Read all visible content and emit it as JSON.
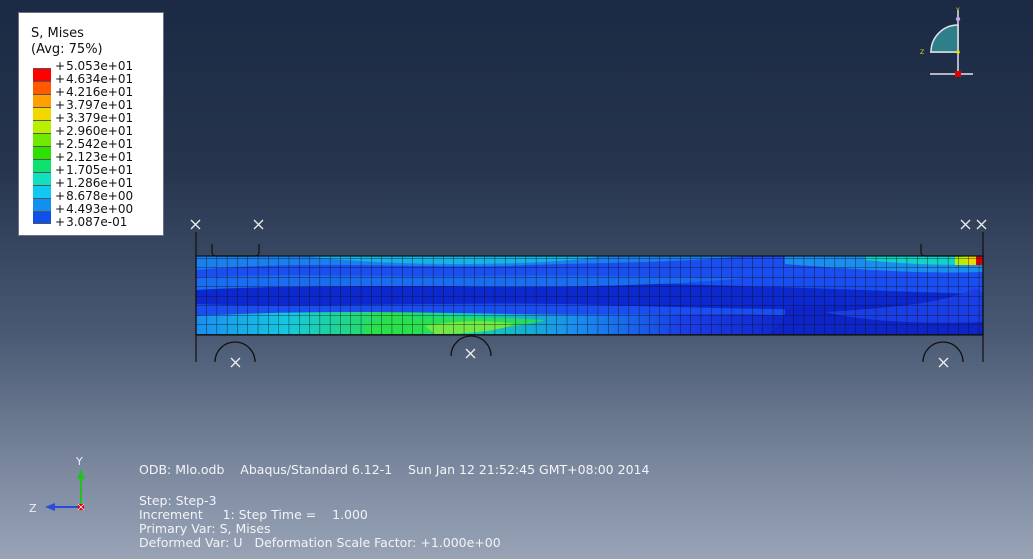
{
  "legend": {
    "title": "S, Mises",
    "subtitle": "(Avg: 75%)",
    "values": [
      "+5.053e+01",
      "+4.634e+01",
      "+4.216e+01",
      "+3.797e+01",
      "+3.379e+01",
      "+2.960e+01",
      "+2.542e+01",
      "+2.123e+01",
      "+1.705e+01",
      "+1.286e+01",
      "+8.678e+00",
      "+4.493e+00",
      "+3.087e-01"
    ],
    "colors": [
      "#ff0000",
      "#ff5a00",
      "#ffa000",
      "#f0d800",
      "#b8f000",
      "#70e800",
      "#2ee000",
      "#10e070",
      "#10e0c0",
      "#10c8f0",
      "#1090f0",
      "#1050e8",
      "#0000e0"
    ]
  },
  "triad_top": {
    "y_label": "Y",
    "z_label": "Z"
  },
  "triad_bottom": {
    "y_label": "Y",
    "z_label": "Z"
  },
  "info": {
    "odb_line": "ODB: Mlo.odb    Abaqus/Standard 6.12-1    Sun Jan 12 21:52:45 GMT+08:00 2014",
    "step_line": "Step: Step-3",
    "increment_line": "Increment     1: Step Time =    1.000",
    "primary_var_line": "Primary Var: S, Mises",
    "deformed_var_line": "Deformed Var: U   Deformation Scale Factor: +1.000e+00"
  },
  "colors": {
    "mesh_line": "#1a1a1a",
    "blue": "#1a3ee6",
    "deep_blue": "#0c24c8",
    "cyan": "#14c8e0",
    "green": "#2ae04a"
  }
}
